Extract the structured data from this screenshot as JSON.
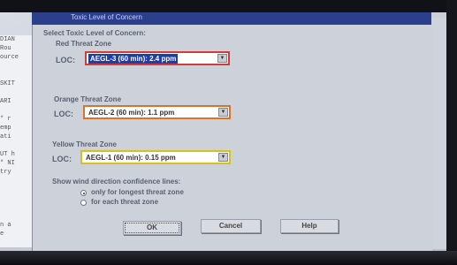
{
  "window": {
    "title": "Toxic Level of Concern"
  },
  "background_text": [
    "DIAN",
    "Rou",
    "ource",
    "",
    "",
    "SKIT",
    "",
    "ARI",
    "",
    "* r",
    "emp",
    "ati",
    "",
    "UT h",
    "* NI",
    "try",
    "",
    "",
    "",
    "",
    "",
    "n a",
    "e"
  ],
  "dialog": {
    "heading": "Select Toxic Level of Concern:",
    "zones": [
      {
        "title": "Red Threat Zone",
        "loc_label": "LOC:",
        "value": "AEGL-3 (60 min): 2.4 ppm",
        "border_color": "#d33a3a",
        "selected": true
      },
      {
        "title": "Orange Threat Zone",
        "loc_label": "LOC:",
        "value": "AEGL-2 (60 min): 1.1 ppm",
        "border_color": "#d9722e",
        "selected": false
      },
      {
        "title": "Yellow Threat Zone",
        "loc_label": "LOC:",
        "value": "AEGL-1 (60 min): 0.15 ppm",
        "border_color": "#d6c21c",
        "selected": false
      }
    ],
    "confidence": {
      "heading": "Show wind direction confidence lines:",
      "options": [
        {
          "label": "only for longest threat zone",
          "checked": true
        },
        {
          "label": "for each threat zone",
          "checked": false
        }
      ]
    },
    "buttons": {
      "ok": "OK",
      "cancel": "Cancel",
      "help": "Help"
    }
  },
  "icons": {
    "dropdown": "chevron-down-icon"
  },
  "colors": {
    "selection_bg": "#1f3da8",
    "title_bar": "#2b3f8c"
  }
}
